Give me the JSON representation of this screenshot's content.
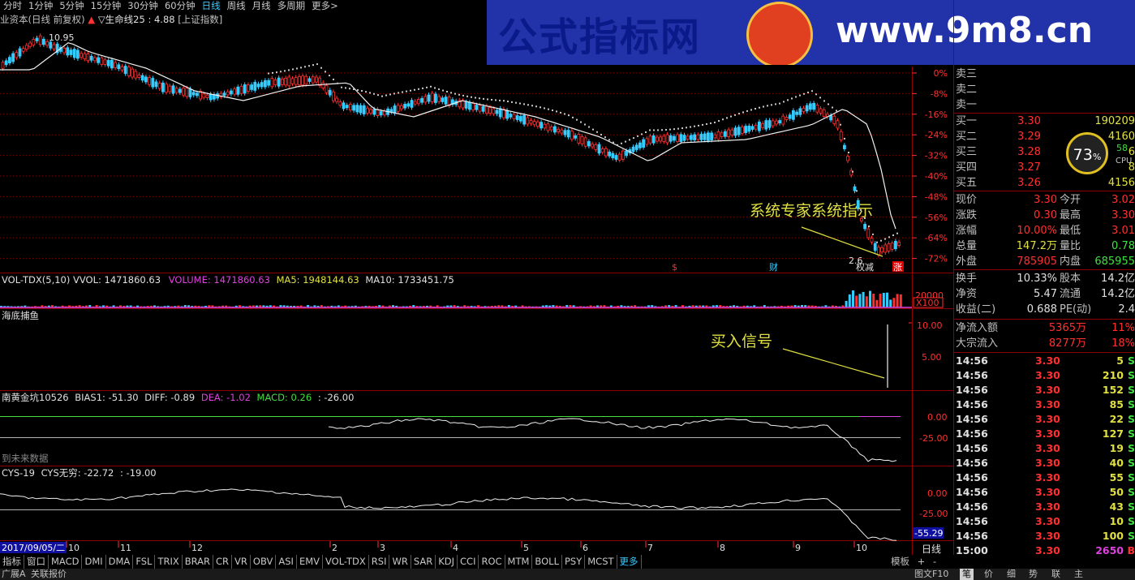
{
  "periods": [
    "分时",
    "1分钟",
    "5分钟",
    "15分钟",
    "30分钟",
    "60分钟",
    "日线",
    "周线",
    "月线",
    "多周期",
    "更多>"
  ],
  "active_period": "日线",
  "banner": {
    "text_cn": "公式指标网",
    "text_url": "www.9m8.cn"
  },
  "title_row": {
    "stock": "业资本(日线 前复权)",
    "arrow": "▲",
    "indicator": "▽生命线25 : 4.88",
    "index": "[上证指数]"
  },
  "main_chart": {
    "high_label": "10.95",
    "low_label": "2.6",
    "annotation": "系统专家系统指示",
    "pct_axis": [
      "0%",
      "-8%",
      "-16%",
      "-24%",
      "-32%",
      "-40%",
      "-48%",
      "-56%",
      "-64%",
      "-72%"
    ],
    "markers": {
      "m1": "$",
      "m2": "财",
      "m3": "权",
      "m4": "减",
      "m5": "涨"
    }
  },
  "volume": {
    "title": "VOL-TDX(5,10) VVOL: 1471860.63",
    "volume": "VOLUME: 1471860.63",
    "ma5": "MA5: 1948144.63",
    "ma10": "MA10: 1733451.75",
    "axis": "20000",
    "unit": "X100"
  },
  "haidi": {
    "title": "海底捕鱼",
    "annotation": "买入信号",
    "axis": [
      "10.00",
      "5.00"
    ]
  },
  "macd": {
    "title": "南黄金坑10526",
    "bias": "BIAS1: -51.30",
    "diff": "DIFF: -0.89",
    "dea": "DEA: -1.02",
    "macd": "MACD: 0.26",
    "extra": ": -26.00",
    "axis": [
      "0.00",
      "-25.00"
    ],
    "note": "到未来数据"
  },
  "cys": {
    "title": "CYS-19",
    "cys": "CYS无穷: -22.72",
    "extra": ": -19.00",
    "axis": [
      "0.00",
      "-25.00"
    ],
    "current": "-55.29"
  },
  "x_axis": {
    "date": "2017/09/05/二",
    "months": [
      "10",
      "11",
      "12",
      "2",
      "3",
      "4",
      "5",
      "6",
      "7",
      "8",
      "9",
      "10"
    ]
  },
  "bottom_tabs": [
    "指标",
    "窗口",
    "MACD",
    "DMI",
    "DMA",
    "FSL",
    "TRIX",
    "BRAR",
    "CR",
    "VR",
    "OBV",
    "ASI",
    "EMV",
    "VOL-TDX",
    "RSI",
    "WR",
    "SAR",
    "KDJ",
    "CCI",
    "ROC",
    "MTM",
    "BOLL",
    "PSY",
    "MCST",
    "更多"
  ],
  "bottom_right": {
    "tpl": "模板",
    "period": "日线",
    "plus": "+",
    "minus": "-"
  },
  "status_bar": {
    "left1": "广展A",
    "left2": "关联报价",
    "right": [
      "图文F10",
      "笔",
      "价",
      "细",
      "势",
      "联",
      "主"
    ]
  },
  "order_book": {
    "sell": [
      {
        "label": "卖三"
      },
      {
        "label": "卖二"
      },
      {
        "label": "卖一"
      }
    ],
    "buy": [
      {
        "label": "买一",
        "price": "3.30",
        "vol": "190209"
      },
      {
        "label": "买二",
        "price": "3.29",
        "vol": "4160"
      },
      {
        "label": "买三",
        "price": "3.28",
        "vol": "6"
      },
      {
        "label": "买四",
        "price": "3.27",
        "vol": "8"
      },
      {
        "label": "买五",
        "price": "3.26",
        "vol": "4156"
      }
    ]
  },
  "cpu": {
    "value": "73",
    "unit": "%",
    "mem": "58",
    "label": "CPU"
  },
  "quote": [
    {
      "l1": "现价",
      "v1": "3.30",
      "l2": "今开",
      "v2": "3.02"
    },
    {
      "l1": "涨跌",
      "v1": "0.30",
      "l2": "最高",
      "v2": "3.30"
    },
    {
      "l1": "涨幅",
      "v1": "10.00%",
      "l2": "最低",
      "v2": "3.01"
    },
    {
      "l1": "总量",
      "v1": "147.2万",
      "l2": "量比",
      "v2": "0.78"
    },
    {
      "l1": "外盘",
      "v1": "785905",
      "l2": "内盘",
      "v2": "685955"
    }
  ],
  "fund": [
    {
      "l1": "换手",
      "v1": "10.33%",
      "l2": "股本",
      "v2": "14.2亿"
    },
    {
      "l1": "净资",
      "v1": "5.47",
      "l2": "流通",
      "v2": "14.2亿"
    },
    {
      "l1": "收益(二)",
      "v1": "0.688",
      "l2": "PE(动)",
      "v2": "2.4"
    }
  ],
  "flow": [
    {
      "l": "净流入额",
      "v": "5365万",
      "p": "11%"
    },
    {
      "l": "大宗流入",
      "v": "8277万",
      "p": "18%"
    }
  ],
  "ticks": [
    {
      "t": "14:56",
      "p": "3.30",
      "v": "5",
      "s": "S"
    },
    {
      "t": "14:56",
      "p": "3.30",
      "v": "210",
      "s": "S"
    },
    {
      "t": "14:56",
      "p": "3.30",
      "v": "152",
      "s": "S"
    },
    {
      "t": "14:56",
      "p": "3.30",
      "v": "85",
      "s": "S"
    },
    {
      "t": "14:56",
      "p": "3.30",
      "v": "22",
      "s": "S"
    },
    {
      "t": "14:56",
      "p": "3.30",
      "v": "127",
      "s": "S"
    },
    {
      "t": "14:56",
      "p": "3.30",
      "v": "19",
      "s": "S"
    },
    {
      "t": "14:56",
      "p": "3.30",
      "v": "40",
      "s": "S"
    },
    {
      "t": "14:56",
      "p": "3.30",
      "v": "55",
      "s": "S"
    },
    {
      "t": "14:56",
      "p": "3.30",
      "v": "50",
      "s": "S"
    },
    {
      "t": "14:56",
      "p": "3.30",
      "v": "43",
      "s": "S"
    },
    {
      "t": "14:56",
      "p": "3.30",
      "v": "10",
      "s": "S"
    },
    {
      "t": "14:56",
      "p": "3.30",
      "v": "100",
      "s": "S"
    },
    {
      "t": "15:00",
      "p": "3.30",
      "v": "2650",
      "s": "B"
    }
  ],
  "colors": {
    "red": "#ff3030",
    "cyan": "#3cf",
    "yellow": "#e0e040",
    "magenta": "#e040e0",
    "green": "#40e040",
    "grid": "#8b0000"
  }
}
